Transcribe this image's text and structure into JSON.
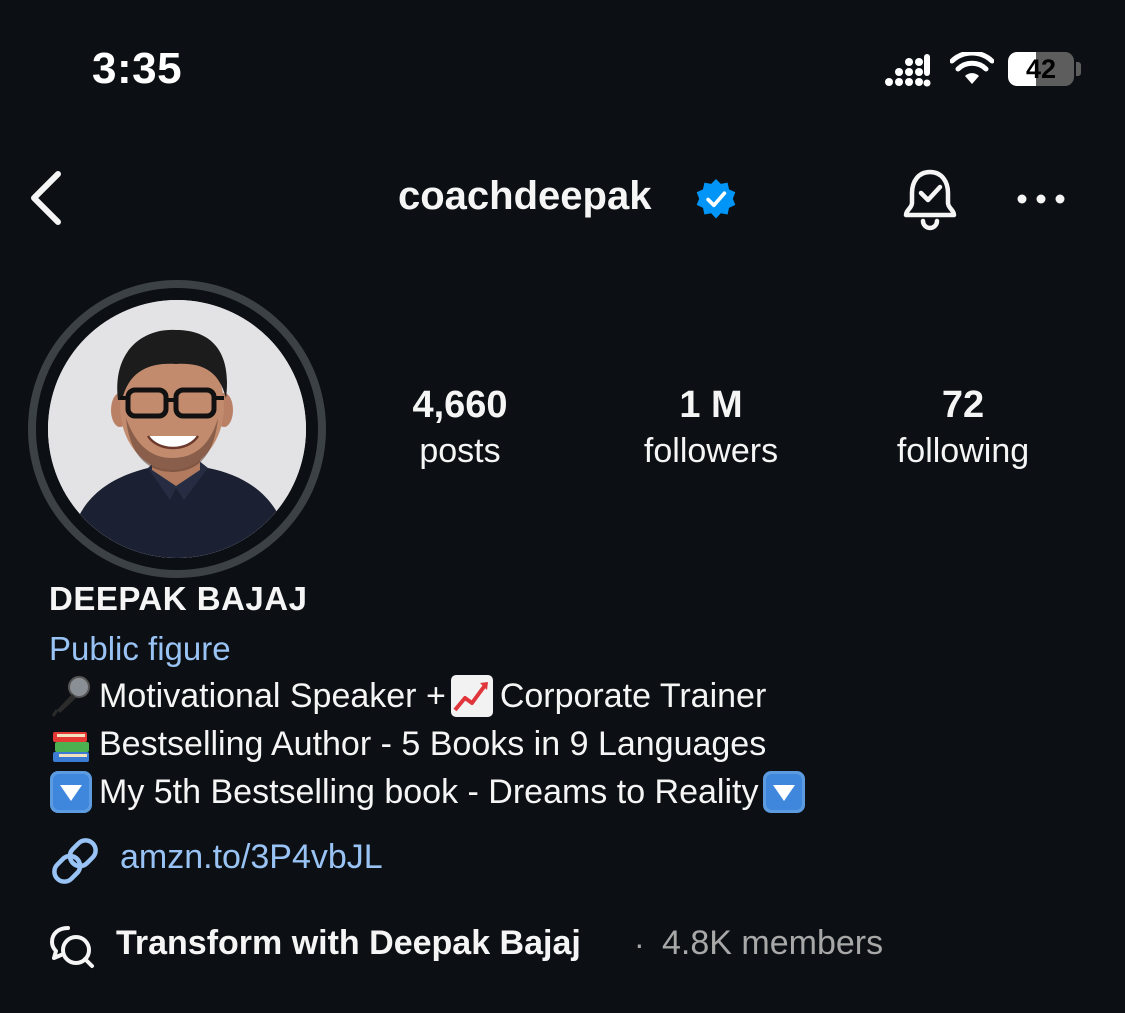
{
  "status_bar": {
    "time": "3:35",
    "battery_percent": "42",
    "battery_level": 0.42
  },
  "header": {
    "username": "coachdeepak",
    "verified": true,
    "icons": [
      "back-chevron-icon",
      "verified-badge-icon",
      "notification-bell-icon",
      "more-options-icon"
    ]
  },
  "stats": {
    "posts": {
      "value": "4,660",
      "label": "posts"
    },
    "followers": {
      "value": "1 M",
      "label": "followers"
    },
    "following": {
      "value": "72",
      "label": "following"
    }
  },
  "profile": {
    "full_name": "DEEPAK BAJAJ",
    "category": "Public figure",
    "bio": {
      "line1_part1": "Motivational Speaker + ",
      "line1_part2": "Corporate Trainer",
      "line2": " Bestselling Author - 5 Books in 9 Languages",
      "line3": " My 5th Bestselling book - Dreams to Reality"
    },
    "link": "amzn.to/3P4vbJL"
  },
  "channel": {
    "name": "Transform with Deepak Bajaj",
    "separator": "·",
    "members": "4.8K members"
  },
  "colors": {
    "background": "#0c1014",
    "text": "#f5f5f5",
    "link": "#99c3f4",
    "secondary": "#a8a8a8",
    "verified": "#0095f6"
  }
}
